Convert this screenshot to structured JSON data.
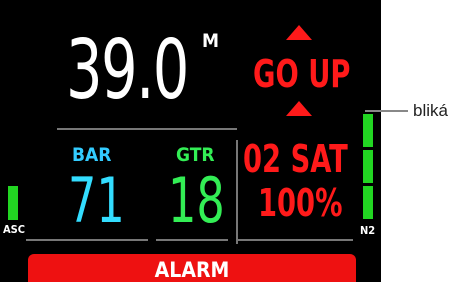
{
  "depth": {
    "value": "39.0",
    "unit": "M"
  },
  "bar": {
    "label": "BAR",
    "value": "71",
    "label_color": "#33ccff"
  },
  "gtr": {
    "label": "GTR",
    "value": "18",
    "label_color": "#33ee55"
  },
  "warning": {
    "go_up": "GO UP",
    "sat_line": "02 SAT",
    "sat_percent": "100%",
    "color": "#ff1a1a"
  },
  "left_indicator": {
    "label": "ASC",
    "color": "#22d622"
  },
  "right_indicator": {
    "label": "N2",
    "color": "#22d622"
  },
  "alarm": {
    "text": "ALARM",
    "color": "#ee1111"
  },
  "annotation": {
    "text": "bliká"
  },
  "icons": {
    "up_arrow": "triangle-up"
  }
}
